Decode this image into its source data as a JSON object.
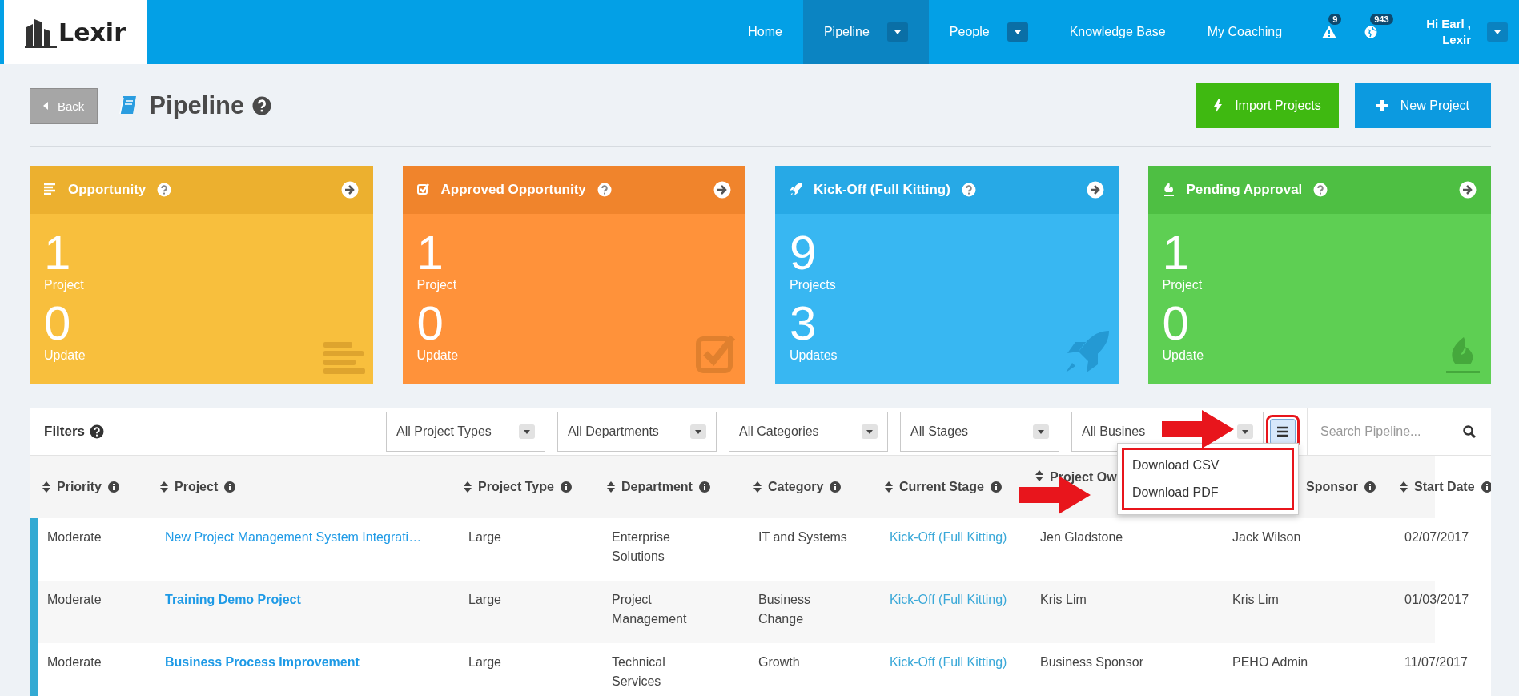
{
  "header": {
    "logo": "Lexir",
    "nav": [
      {
        "label": "Home",
        "selected": false,
        "has_menu": false
      },
      {
        "label": "Pipeline",
        "selected": true,
        "has_menu": true
      },
      {
        "label": "People",
        "selected": false,
        "has_menu": true
      },
      {
        "label": "Knowledge Base",
        "selected": false,
        "has_menu": false
      },
      {
        "label": "My Coaching",
        "selected": false,
        "has_menu": false
      }
    ],
    "alerts": [
      {
        "kind": "warning",
        "count": "9"
      },
      {
        "kind": "globe",
        "count": "943"
      }
    ],
    "user": {
      "greeting": "Hi Earl ,",
      "name": "Lexir"
    }
  },
  "page": {
    "back": "Back",
    "title": "Pipeline",
    "actions": [
      {
        "kind": "import",
        "label": "Import Projects"
      },
      {
        "kind": "new",
        "label": "New Project"
      }
    ]
  },
  "cards": [
    {
      "kind": "list",
      "title": "Opportunity",
      "count": "1",
      "count_label": "Project",
      "updates": "0",
      "updates_label": "Update"
    },
    {
      "kind": "check",
      "title": "Approved Opportunity",
      "count": "1",
      "count_label": "Project",
      "updates": "0",
      "updates_label": "Update"
    },
    {
      "kind": "rocket",
      "title": "Kick-Off (Full Kitting)",
      "count": "9",
      "count_label": "Projects",
      "updates": "3",
      "updates_label": "Updates"
    },
    {
      "kind": "fire",
      "title": "Pending Approval",
      "count": "1",
      "count_label": "Project",
      "updates": "0",
      "updates_label": "Update"
    }
  ],
  "filters": {
    "label": "Filters",
    "selects": [
      "All Project Types",
      "All Departments",
      "All Categories",
      "All Stages",
      "All Busines"
    ],
    "search": {
      "placeholder": "Search Pipeline..."
    },
    "menu": {
      "expanded": true,
      "items": [
        "Download CSV",
        "Download PDF"
      ]
    }
  },
  "table": {
    "columns": [
      "Priority",
      "Project",
      "Project Type",
      "Department",
      "Category",
      "Current Stage",
      "Project Ow",
      "Sponsor",
      "Start Date"
    ],
    "rows": [
      {
        "cells": [
          "Moderate",
          "New Project Management System Integrati…",
          "Large",
          "Enterprise Solutions",
          "IT and Systems",
          "Kick-Off (Full Kitting)",
          "Jen Gladstone",
          "Jack Wilson",
          "02/07/2017"
        ],
        "bold": false
      },
      {
        "cells": [
          "Moderate",
          "Training Demo Project",
          "Large",
          "Project Management",
          "Business Change",
          "Kick-Off (Full Kitting)",
          "Kris Lim",
          "Kris Lim",
          "01/03/2017"
        ],
        "bold": true
      },
      {
        "cells": [
          "Moderate",
          "Business Process Improvement",
          "Large",
          "Technical Services",
          "Growth",
          "Kick-Off (Full Kitting)",
          "Business Sponsor",
          "PEHO Admin",
          "11/07/2017"
        ],
        "bold": true
      }
    ]
  }
}
